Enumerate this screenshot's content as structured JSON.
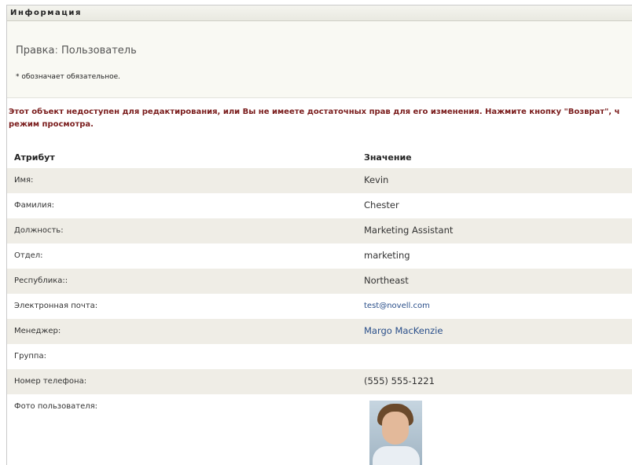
{
  "panel": {
    "title": "Информация"
  },
  "header": {
    "edit_label": "Правка",
    "edit_sep": ":",
    "object_type": "Пользователь",
    "required_note": "* обозначает обязательное."
  },
  "warning": {
    "line1": "Этот объект недоступен для редактирования, или Вы не имеете достаточных прав для его изменения. Нажмите кнопку \"Возврат\", ч",
    "line2": "режим просмотра."
  },
  "table": {
    "col_attribute": "Атрибут",
    "col_value": "Значение",
    "rows": [
      {
        "attr": "Имя:",
        "value": "Kevin"
      },
      {
        "attr": "Фамилия:",
        "value": "Chester"
      },
      {
        "attr": "Должность:",
        "value": "Marketing Assistant"
      },
      {
        "attr": "Отдел:",
        "value": "marketing"
      },
      {
        "attr": "Республика::",
        "value": "Northeast"
      },
      {
        "attr": "Электронная почта:",
        "value": "test@novell.com"
      },
      {
        "attr": "Менеджер:",
        "value": "Margo MacKenzie"
      },
      {
        "attr": "Группа:",
        "value": ""
      },
      {
        "attr": "Номер телефона:",
        "value": "(555) 555-1221"
      },
      {
        "attr": "Фото пользователя:",
        "value": ""
      }
    ]
  },
  "colors": {
    "warning": "#7a1c1c",
    "link": "#2a4f8a",
    "row_alt": "#efede6"
  }
}
